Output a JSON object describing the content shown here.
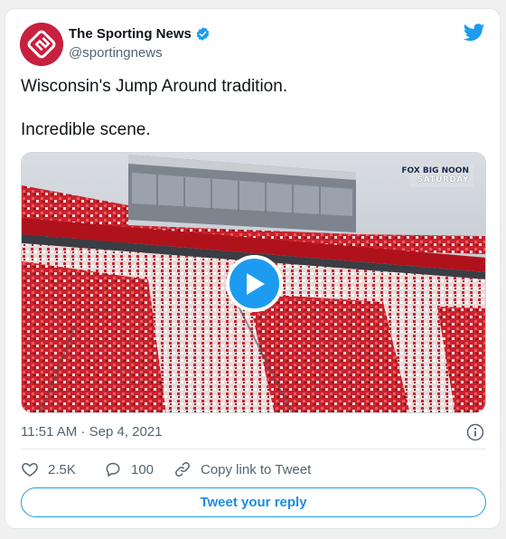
{
  "author": {
    "name": "The Sporting News",
    "handle": "@sportingnews",
    "verified": true
  },
  "tweet": {
    "lines": [
      "Wisconsin's Jump Around tradition.",
      "Incredible scene."
    ]
  },
  "media": {
    "broadcast_logo_line1": "FOX BIG NOON",
    "broadcast_logo_line2": "SATURDAY",
    "play_icon": "play-icon"
  },
  "meta": {
    "timestamp": "11:51 AM · Sep 4, 2021"
  },
  "actions": {
    "likes": "2.5K",
    "replies": "100",
    "copy_link": "Copy link to Tweet"
  },
  "reply_button": "Tweet your reply",
  "colors": {
    "accent": "#1d9bf0",
    "brand_avatar": "#c8203f",
    "muted_text": "#536471"
  }
}
